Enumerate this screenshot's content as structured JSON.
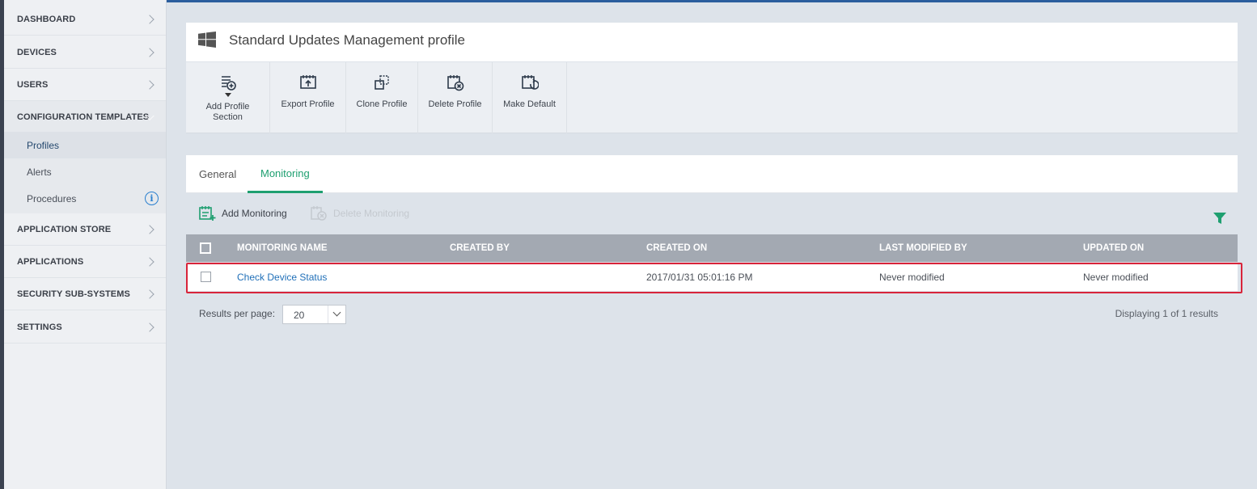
{
  "sidebar": {
    "items": [
      {
        "label": "DASHBOARD"
      },
      {
        "label": "DEVICES"
      },
      {
        "label": "USERS"
      },
      {
        "label": "CONFIGURATION TEMPLATES"
      },
      {
        "label": "APPLICATION STORE"
      },
      {
        "label": "APPLICATIONS"
      },
      {
        "label": "SECURITY SUB-SYSTEMS"
      },
      {
        "label": "SETTINGS"
      }
    ],
    "sub_items": [
      {
        "label": "Profiles",
        "active": true
      },
      {
        "label": "Alerts"
      },
      {
        "label": "Procedures"
      }
    ]
  },
  "header": {
    "title": "Standard Updates Management profile",
    "icon": "windows-logo-icon"
  },
  "toolbar": {
    "add_profile_section_line1": "Add Profile",
    "add_profile_section_line2": "Section",
    "export_profile": "Export Profile",
    "clone_profile": "Clone Profile",
    "delete_profile": "Delete Profile",
    "make_default": "Make Default"
  },
  "tabs": [
    {
      "label": "General"
    },
    {
      "label": "Monitoring",
      "active": true
    }
  ],
  "actions": {
    "add_monitoring": "Add Monitoring",
    "delete_monitoring": "Delete Monitoring"
  },
  "table": {
    "columns": [
      "MONITORING NAME",
      "CREATED BY",
      "CREATED ON",
      "LAST MODIFIED BY",
      "UPDATED ON"
    ],
    "rows": [
      {
        "monitoring_name": "Check Device Status",
        "created_by": "",
        "created_on": "2017/01/31 05:01:16 PM",
        "last_modified_by": "Never modified",
        "updated_on": "Never modified"
      }
    ]
  },
  "footer": {
    "results_per_page_label": "Results per page:",
    "results_per_page_value": "20",
    "results_info": "Displaying 1 of 1 results"
  },
  "colors": {
    "accent_green": "#1e9f70",
    "link_blue": "#1f6fb8",
    "highlight_red": "#d8243a",
    "header_gray": "#a3a9b2"
  }
}
